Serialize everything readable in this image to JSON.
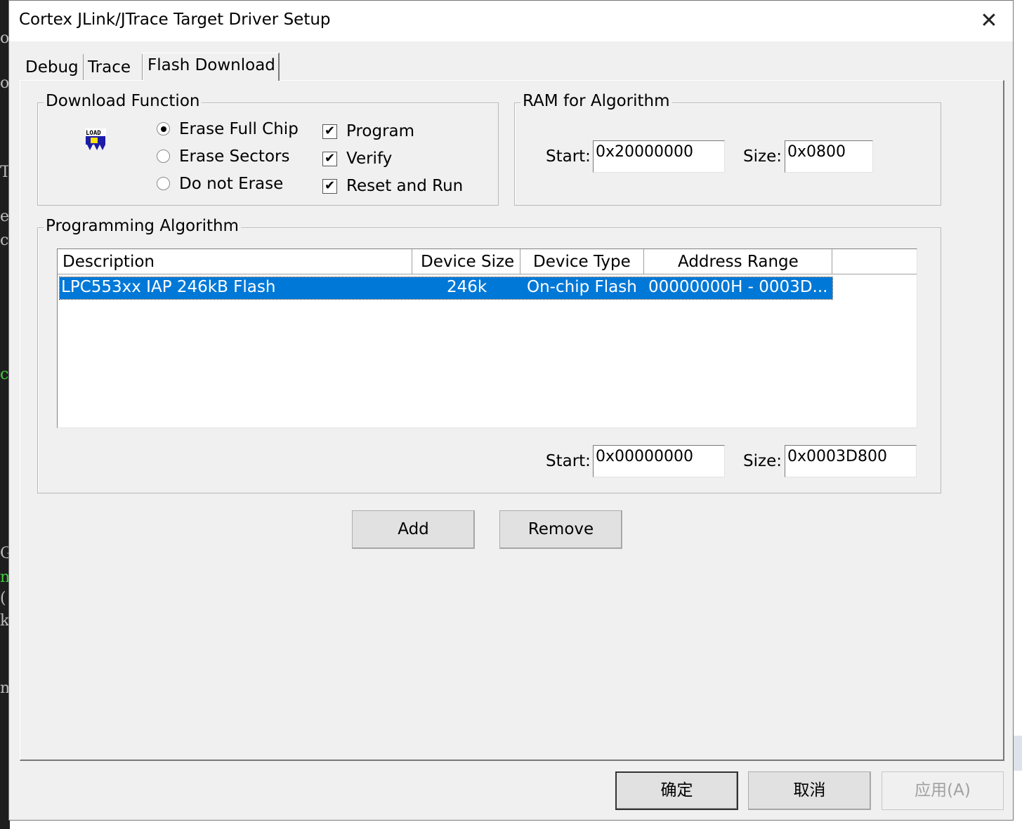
{
  "window": {
    "title": "Cortex JLink/JTrace Target Driver Setup"
  },
  "tabs": [
    {
      "label": "Debug"
    },
    {
      "label": "Trace"
    },
    {
      "label": "Flash Download"
    }
  ],
  "download_function": {
    "group_title": "Download Function",
    "icon": "load-icon",
    "erase_options": [
      {
        "label": "Erase Full Chip",
        "selected": true
      },
      {
        "label": "Erase Sectors",
        "selected": false
      },
      {
        "label": "Do not Erase",
        "selected": false
      }
    ],
    "checkboxes": [
      {
        "label": "Program",
        "checked": true
      },
      {
        "label": "Verify",
        "checked": true
      },
      {
        "label": "Reset and Run",
        "checked": true
      }
    ]
  },
  "ram_for_algorithm": {
    "group_title": "RAM for Algorithm",
    "start_label": "Start:",
    "start_value": "0x20000000",
    "size_label": "Size:",
    "size_value": "0x0800"
  },
  "programming_algorithm": {
    "group_title": "Programming Algorithm",
    "columns": [
      "Description",
      "Device Size",
      "Device Type",
      "Address Range"
    ],
    "rows": [
      {
        "description": "LPC553xx IAP 246kB Flash",
        "device_size": "246k",
        "device_type": "On-chip Flash",
        "address_range": "00000000H - 0003D...",
        "selected": true
      }
    ],
    "start_label": "Start:",
    "start_value": "0x00000000",
    "size_label": "Size:",
    "size_value": "0x0003D800"
  },
  "buttons": {
    "add": "Add",
    "remove": "Remove",
    "ok": "确定",
    "cancel": "取消",
    "apply": "应用(A)"
  },
  "background_fragments": [
    "o",
    "o",
    "T",
    "e",
    "c",
    "c",
    "G",
    "n",
    "(",
    "k",
    "n"
  ],
  "colors": {
    "selection": "#0078d7",
    "dialog_bg": "#f0f0f0",
    "disabled_text": "#a0a0a0"
  }
}
